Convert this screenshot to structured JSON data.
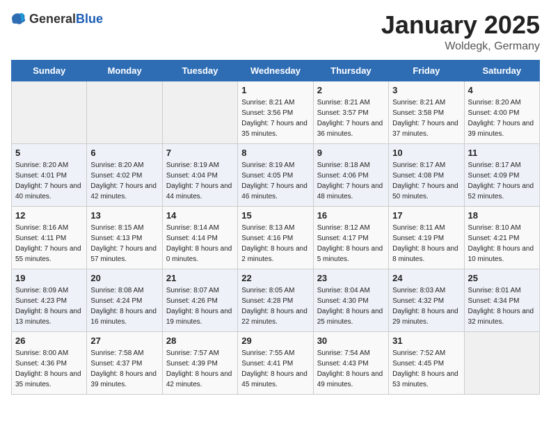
{
  "logo": {
    "general": "General",
    "blue": "Blue"
  },
  "header": {
    "month": "January 2025",
    "location": "Woldegk, Germany"
  },
  "weekdays": [
    "Sunday",
    "Monday",
    "Tuesday",
    "Wednesday",
    "Thursday",
    "Friday",
    "Saturday"
  ],
  "weeks": [
    [
      {
        "day": "",
        "info": ""
      },
      {
        "day": "",
        "info": ""
      },
      {
        "day": "",
        "info": ""
      },
      {
        "day": "1",
        "info": "Sunrise: 8:21 AM\nSunset: 3:56 PM\nDaylight: 7 hours and 35 minutes."
      },
      {
        "day": "2",
        "info": "Sunrise: 8:21 AM\nSunset: 3:57 PM\nDaylight: 7 hours and 36 minutes."
      },
      {
        "day": "3",
        "info": "Sunrise: 8:21 AM\nSunset: 3:58 PM\nDaylight: 7 hours and 37 minutes."
      },
      {
        "day": "4",
        "info": "Sunrise: 8:20 AM\nSunset: 4:00 PM\nDaylight: 7 hours and 39 minutes."
      }
    ],
    [
      {
        "day": "5",
        "info": "Sunrise: 8:20 AM\nSunset: 4:01 PM\nDaylight: 7 hours and 40 minutes."
      },
      {
        "day": "6",
        "info": "Sunrise: 8:20 AM\nSunset: 4:02 PM\nDaylight: 7 hours and 42 minutes."
      },
      {
        "day": "7",
        "info": "Sunrise: 8:19 AM\nSunset: 4:04 PM\nDaylight: 7 hours and 44 minutes."
      },
      {
        "day": "8",
        "info": "Sunrise: 8:19 AM\nSunset: 4:05 PM\nDaylight: 7 hours and 46 minutes."
      },
      {
        "day": "9",
        "info": "Sunrise: 8:18 AM\nSunset: 4:06 PM\nDaylight: 7 hours and 48 minutes."
      },
      {
        "day": "10",
        "info": "Sunrise: 8:17 AM\nSunset: 4:08 PM\nDaylight: 7 hours and 50 minutes."
      },
      {
        "day": "11",
        "info": "Sunrise: 8:17 AM\nSunset: 4:09 PM\nDaylight: 7 hours and 52 minutes."
      }
    ],
    [
      {
        "day": "12",
        "info": "Sunrise: 8:16 AM\nSunset: 4:11 PM\nDaylight: 7 hours and 55 minutes."
      },
      {
        "day": "13",
        "info": "Sunrise: 8:15 AM\nSunset: 4:13 PM\nDaylight: 7 hours and 57 minutes."
      },
      {
        "day": "14",
        "info": "Sunrise: 8:14 AM\nSunset: 4:14 PM\nDaylight: 8 hours and 0 minutes."
      },
      {
        "day": "15",
        "info": "Sunrise: 8:13 AM\nSunset: 4:16 PM\nDaylight: 8 hours and 2 minutes."
      },
      {
        "day": "16",
        "info": "Sunrise: 8:12 AM\nSunset: 4:17 PM\nDaylight: 8 hours and 5 minutes."
      },
      {
        "day": "17",
        "info": "Sunrise: 8:11 AM\nSunset: 4:19 PM\nDaylight: 8 hours and 8 minutes."
      },
      {
        "day": "18",
        "info": "Sunrise: 8:10 AM\nSunset: 4:21 PM\nDaylight: 8 hours and 10 minutes."
      }
    ],
    [
      {
        "day": "19",
        "info": "Sunrise: 8:09 AM\nSunset: 4:23 PM\nDaylight: 8 hours and 13 minutes."
      },
      {
        "day": "20",
        "info": "Sunrise: 8:08 AM\nSunset: 4:24 PM\nDaylight: 8 hours and 16 minutes."
      },
      {
        "day": "21",
        "info": "Sunrise: 8:07 AM\nSunset: 4:26 PM\nDaylight: 8 hours and 19 minutes."
      },
      {
        "day": "22",
        "info": "Sunrise: 8:05 AM\nSunset: 4:28 PM\nDaylight: 8 hours and 22 minutes."
      },
      {
        "day": "23",
        "info": "Sunrise: 8:04 AM\nSunset: 4:30 PM\nDaylight: 8 hours and 25 minutes."
      },
      {
        "day": "24",
        "info": "Sunrise: 8:03 AM\nSunset: 4:32 PM\nDaylight: 8 hours and 29 minutes."
      },
      {
        "day": "25",
        "info": "Sunrise: 8:01 AM\nSunset: 4:34 PM\nDaylight: 8 hours and 32 minutes."
      }
    ],
    [
      {
        "day": "26",
        "info": "Sunrise: 8:00 AM\nSunset: 4:36 PM\nDaylight: 8 hours and 35 minutes."
      },
      {
        "day": "27",
        "info": "Sunrise: 7:58 AM\nSunset: 4:37 PM\nDaylight: 8 hours and 39 minutes."
      },
      {
        "day": "28",
        "info": "Sunrise: 7:57 AM\nSunset: 4:39 PM\nDaylight: 8 hours and 42 minutes."
      },
      {
        "day": "29",
        "info": "Sunrise: 7:55 AM\nSunset: 4:41 PM\nDaylight: 8 hours and 45 minutes."
      },
      {
        "day": "30",
        "info": "Sunrise: 7:54 AM\nSunset: 4:43 PM\nDaylight: 8 hours and 49 minutes."
      },
      {
        "day": "31",
        "info": "Sunrise: 7:52 AM\nSunset: 4:45 PM\nDaylight: 8 hours and 53 minutes."
      },
      {
        "day": "",
        "info": ""
      }
    ]
  ]
}
